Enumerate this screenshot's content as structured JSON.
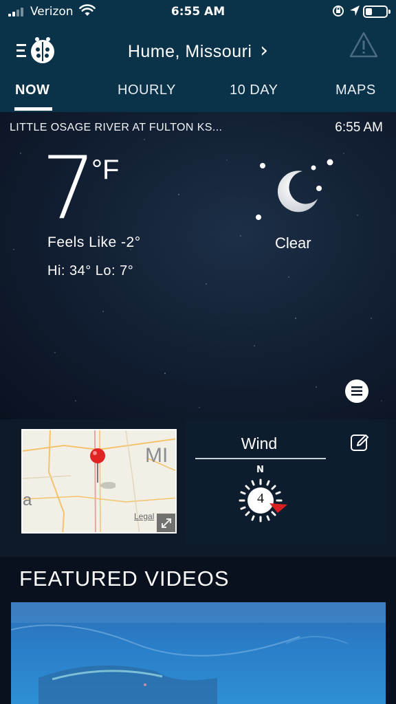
{
  "status_bar": {
    "carrier": "Verizon",
    "time": "6:55 AM"
  },
  "header": {
    "location": "Hume, Missouri",
    "location_chevron": "›"
  },
  "tabs": [
    {
      "label": "NOW",
      "active": true
    },
    {
      "label": "HOURLY",
      "active": false
    },
    {
      "label": "10 DAY",
      "active": false
    },
    {
      "label": "MAPS",
      "active": false
    }
  ],
  "current": {
    "station": "LITTLE OSAGE RIVER AT FULTON KS...",
    "observation_time": "6:55 AM",
    "temperature": "7",
    "unit": "°F",
    "feels_like": "Feels Like -2°",
    "hi_lo": "Hi: 34°  Lo: 7°",
    "condition": "Clear",
    "condition_icon": "moon-stars-icon"
  },
  "map_card": {
    "label_state": "MI",
    "label_partial": "a",
    "legal": "Legal"
  },
  "wind_card": {
    "title": "Wind",
    "compass_north": "N",
    "speed": "4"
  },
  "featured_videos": {
    "title": "FEATURED VIDEOS"
  },
  "colors": {
    "header_bg": "#0a3349",
    "accent_red": "#d92020",
    "pin_red": "#e02424"
  }
}
